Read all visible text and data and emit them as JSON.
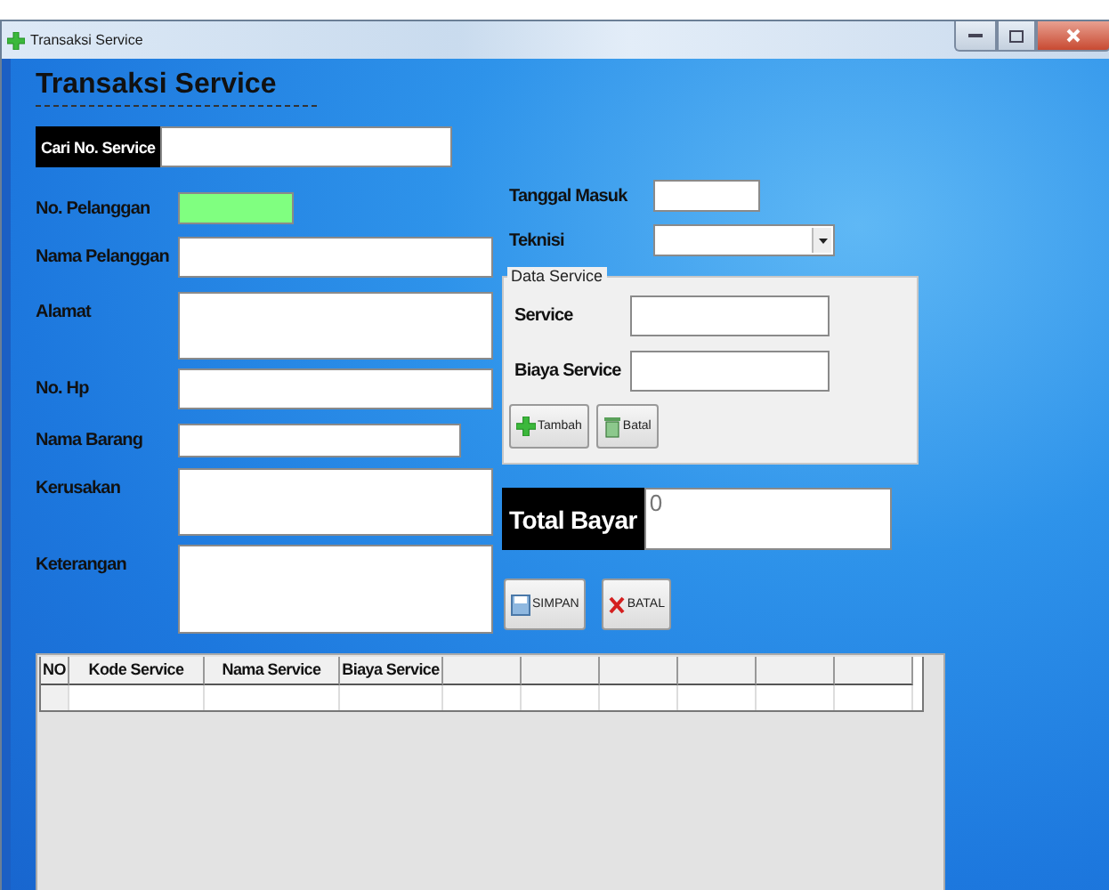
{
  "window": {
    "title": "Transaksi Service"
  },
  "form_title": "Transaksi Service",
  "search": {
    "label": "Cari No. Service"
  },
  "customer_fields": [
    {
      "label": "No. Pelanggan",
      "read_only": true
    },
    {
      "label": "Nama Pelanggan",
      "read_only": false
    },
    {
      "label": "Alamat",
      "read_only": false
    },
    {
      "label": "No. Hp",
      "read_only": false
    },
    {
      "label": "Nama Barang",
      "read_only": false
    },
    {
      "label": "Kerusakan",
      "read_only": false
    },
    {
      "label": "Keterangan",
      "read_only": false
    }
  ],
  "tanggal_masuk": {
    "label": "Tanggal Masuk"
  },
  "teknisi": {
    "label": "Teknisi"
  },
  "data_service": {
    "title": "Data Service",
    "fields": [
      {
        "label": "Service"
      },
      {
        "label": "Biaya Service"
      }
    ],
    "buttons": [
      {
        "kind": "add",
        "label": "Tambah"
      },
      {
        "kind": "cancel",
        "label": "Batal"
      }
    ]
  },
  "total": {
    "label": "Total Bayar",
    "value": "0"
  },
  "actions": [
    {
      "kind": "save",
      "label": "SIMPAN"
    },
    {
      "kind": "close",
      "label": "BATAL"
    }
  ],
  "table": {
    "columns": [
      {
        "kind": "header",
        "label": "NO"
      },
      {
        "kind": "header",
        "label": "Kode Service"
      },
      {
        "kind": "header",
        "label": "Nama Service"
      },
      {
        "kind": "header",
        "label": "Biaya Service"
      },
      {
        "kind": "blank"
      },
      {
        "kind": "blank"
      },
      {
        "kind": "blank"
      },
      {
        "kind": "blank"
      },
      {
        "kind": "blank"
      },
      {
        "kind": "blank"
      }
    ]
  }
}
